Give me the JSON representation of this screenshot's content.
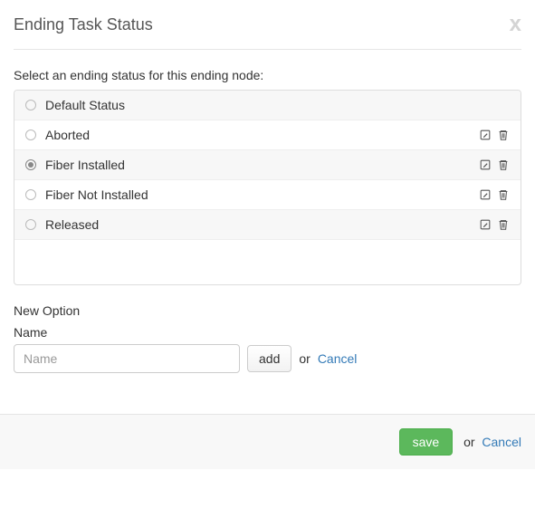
{
  "header": {
    "title": "Ending Task Status",
    "close": "x"
  },
  "instruction": "Select an ending status for this ending node:",
  "statuses": [
    {
      "label": "Default Status",
      "selected": false,
      "editable": false
    },
    {
      "label": "Aborted",
      "selected": false,
      "editable": true
    },
    {
      "label": "Fiber Installed",
      "selected": true,
      "editable": true
    },
    {
      "label": "Fiber Not Installed",
      "selected": false,
      "editable": true
    },
    {
      "label": "Released",
      "selected": false,
      "editable": true
    }
  ],
  "newOption": {
    "title": "New Option",
    "fieldLabel": "Name",
    "placeholder": "Name",
    "addLabel": "add",
    "or": "or",
    "cancel": "Cancel"
  },
  "footer": {
    "save": "save",
    "or": "or",
    "cancel": "Cancel"
  }
}
